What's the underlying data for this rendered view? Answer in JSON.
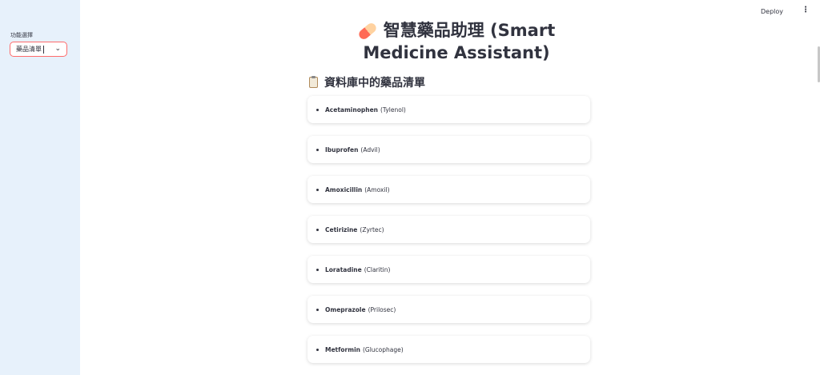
{
  "sidebar": {
    "label": "功能選擇",
    "select_value": "藥品清單"
  },
  "topbar": {
    "deploy": "Deploy",
    "menu": "⋮"
  },
  "main": {
    "title": "智慧藥品助理 (Smart Medicine Assistant)",
    "subheader": "資料庫中的藥品清單",
    "drugs": [
      {
        "name": "Acetaminophen",
        "brand": "(Tylenol)"
      },
      {
        "name": "Ibuprofen",
        "brand": "(Advil)"
      },
      {
        "name": "Amoxicillin",
        "brand": "(Amoxil)"
      },
      {
        "name": "Cetirizine",
        "brand": "(Zyrtec)"
      },
      {
        "name": "Loratadine",
        "brand": "(Claritin)"
      },
      {
        "name": "Omeprazole",
        "brand": "(Prilosec)"
      },
      {
        "name": "Metformin",
        "brand": "(Glucophage)"
      }
    ]
  },
  "icons": {
    "title": "pill-icon",
    "subheader": "clipboard-icon",
    "select": "chevron-down-icon"
  },
  "colors": {
    "sidebar_bg": "#e7f1fb",
    "select_border": "#ff6b6b"
  }
}
